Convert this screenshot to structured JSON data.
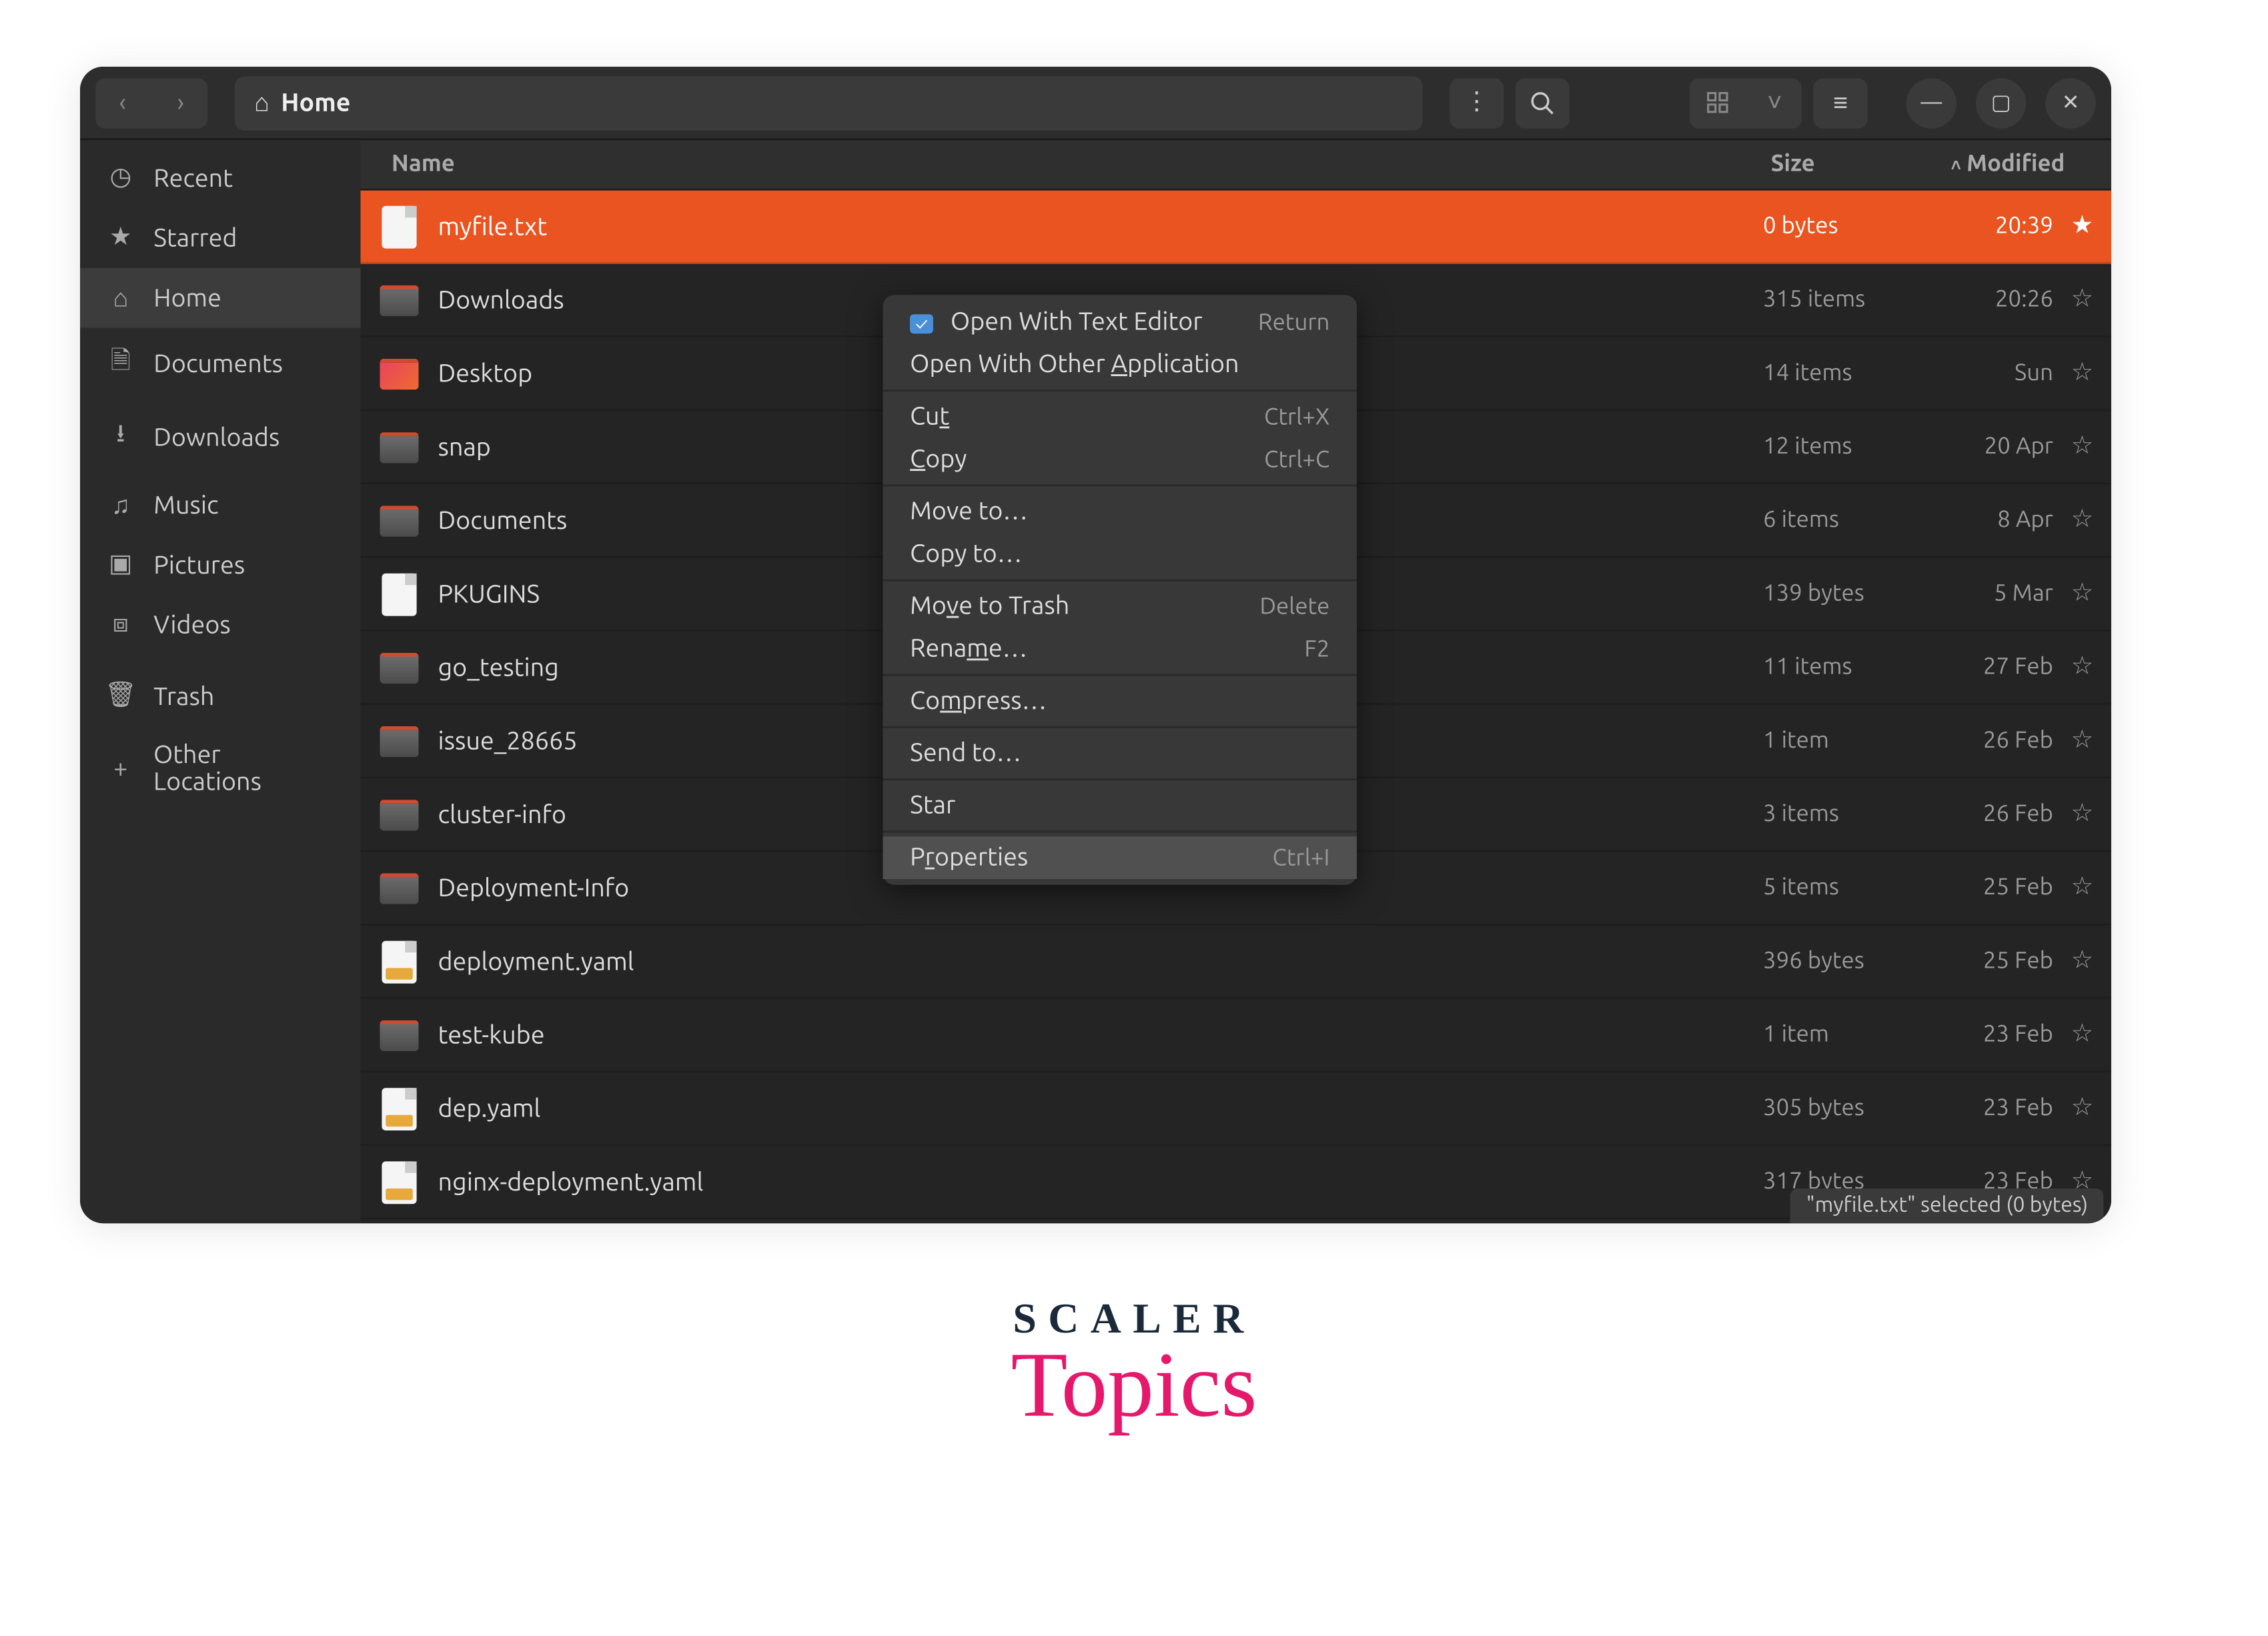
{
  "titlebar": {
    "location": "Home"
  },
  "sidebar": {
    "items": [
      {
        "label": "Recent",
        "icon": "clock"
      },
      {
        "label": "Starred",
        "icon": "star"
      },
      {
        "label": "Home",
        "icon": "home",
        "active": true
      },
      {
        "label": "Documents",
        "icon": "doc"
      },
      {
        "label": "Downloads",
        "icon": "down"
      },
      {
        "label": "Music",
        "icon": "music"
      },
      {
        "label": "Pictures",
        "icon": "pic"
      },
      {
        "label": "Videos",
        "icon": "vid"
      },
      {
        "label": "Trash",
        "icon": "trash"
      },
      {
        "label": "Other Locations",
        "icon": "plus"
      }
    ]
  },
  "columns": {
    "name": "Name",
    "size": "Size",
    "modified": "Modified"
  },
  "files": [
    {
      "name": "myfile.txt",
      "size": "0 bytes",
      "modified": "20:39",
      "type": "file",
      "selected": true,
      "starred": true
    },
    {
      "name": "Downloads",
      "size": "315 items",
      "modified": "20:26",
      "type": "folder"
    },
    {
      "name": "Desktop",
      "size": "14 items",
      "modified": "Sun",
      "type": "folder-special"
    },
    {
      "name": "snap",
      "size": "12 items",
      "modified": "20 Apr",
      "type": "folder"
    },
    {
      "name": "Documents",
      "size": "6 items",
      "modified": "8 Apr",
      "type": "folder"
    },
    {
      "name": "PKUGINS",
      "size": "139 bytes",
      "modified": "5 Mar",
      "type": "file"
    },
    {
      "name": "go_testing",
      "size": "11 items",
      "modified": "27 Feb",
      "type": "folder"
    },
    {
      "name": "issue_28665",
      "size": "1 item",
      "modified": "26 Feb",
      "type": "folder"
    },
    {
      "name": "cluster-info",
      "size": "3 items",
      "modified": "26 Feb",
      "type": "folder"
    },
    {
      "name": "Deployment-Info",
      "size": "5 items",
      "modified": "25 Feb",
      "type": "folder"
    },
    {
      "name": "deployment.yaml",
      "size": "396 bytes",
      "modified": "25 Feb",
      "type": "yaml"
    },
    {
      "name": "test-kube",
      "size": "1 item",
      "modified": "23 Feb",
      "type": "folder"
    },
    {
      "name": "dep.yaml",
      "size": "305 bytes",
      "modified": "23 Feb",
      "type": "yaml"
    },
    {
      "name": "nginx-deployment.yaml",
      "size": "317 bytes",
      "modified": "23 Feb",
      "type": "yaml"
    }
  ],
  "context_menu": {
    "items": [
      {
        "label": "Open With Text Editor",
        "accel": "Return",
        "checked": true
      },
      {
        "label_html": "Open With Other <u>A</u>pplication"
      },
      {
        "sep": true
      },
      {
        "label_html": "Cu<u>t</u>",
        "accel": "Ctrl+X"
      },
      {
        "label_html": "<u>C</u>opy",
        "accel": "Ctrl+C"
      },
      {
        "sep": true
      },
      {
        "label": "Move to…"
      },
      {
        "label": "Copy to…"
      },
      {
        "sep": true
      },
      {
        "label_html": "Mo<u>v</u>e to Trash",
        "accel": "Delete"
      },
      {
        "label_html": "Rena<u>m</u>e…",
        "accel": "F2"
      },
      {
        "sep": true
      },
      {
        "label_html": "Co<u>m</u>press…"
      },
      {
        "sep": true
      },
      {
        "label": "Send to…"
      },
      {
        "sep": true
      },
      {
        "label": "Star"
      },
      {
        "sep": true
      },
      {
        "label_html": "P<u>r</u>operties",
        "accel": "Ctrl+I",
        "highlight": true
      }
    ]
  },
  "status_bar": "\"myfile.txt\" selected (0 bytes)",
  "brand": {
    "top": "SCALER",
    "bottom": "Topics"
  }
}
